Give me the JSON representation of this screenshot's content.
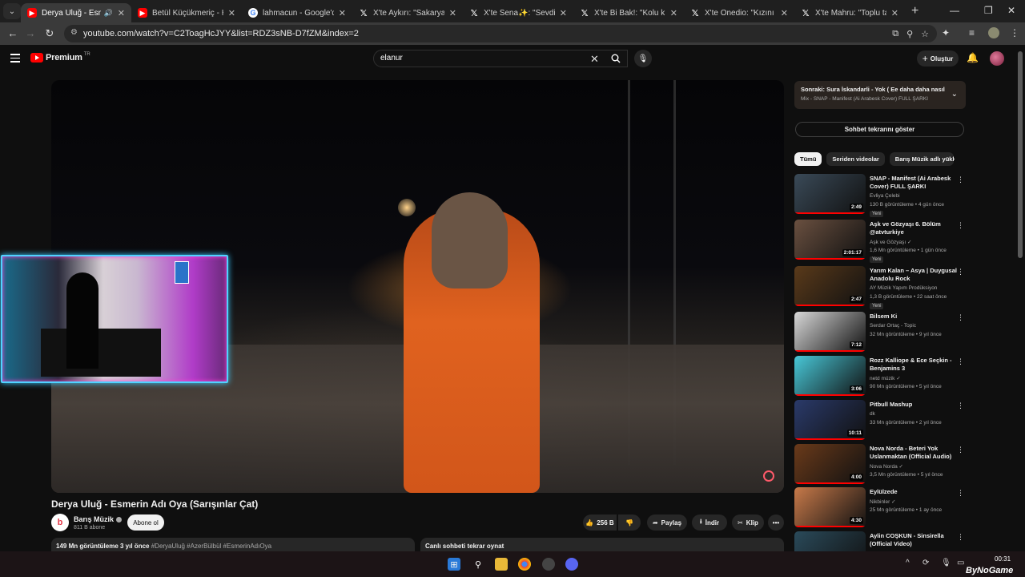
{
  "browser": {
    "tabs": [
      {
        "title": "Derya Uluğ - Esmerin",
        "fav": "yt",
        "active": true,
        "audio": true
      },
      {
        "title": "Betül Küçükmeriç - Helele",
        "fav": "yt"
      },
      {
        "title": "lahmacun - Google'da Ara",
        "fav": "g"
      },
      {
        "title": "X'te Aykırı: \"Sakarya'da bi",
        "fav": "x"
      },
      {
        "title": "X'te Sena✨: \"Sevdiğin a",
        "fav": "x"
      },
      {
        "title": "X'te Bi Bak!: \"Kolu kırılan",
        "fav": "x"
      },
      {
        "title": "X'te Onedio: \"Kızını sürekl",
        "fav": "x"
      },
      {
        "title": "X'te Mahru: \"Toplu taşıma",
        "fav": "x"
      }
    ],
    "new_tab": "+",
    "url": "youtube.com/watch?v=C2ToagHcJYY&list=RDZ3sNB-D7fZM&index=2"
  },
  "youtube": {
    "brand": "Premium",
    "brand_sup": "TR",
    "search_value": "elanur",
    "create_label": "Oluştur",
    "video": {
      "title": "Derya Uluğ - Esmerin Adı Oya (Sarışınlar Çat)",
      "channel": "Barış Müzik",
      "subscribers": "811 B abone",
      "subscribe_label": "Abone ol",
      "likes": "256 B",
      "share_label": "Paylaş",
      "download_label": "İndir",
      "clip_label": "Klip",
      "more_label": "•••",
      "views_date": "149 Mn görüntüleme  3 yıl önce",
      "tags": "#DeryaUluğ #AzerBülbül #EsmerinAdıOya",
      "chat_replay": "Canlı sohbeti tekrar oynat"
    },
    "next_up": {
      "title": "Sonraki: Sura İskandarli - Yok ( Ee daha daha nasılsın",
      "subtitle": "Mix - SNAP - Manifest (Ai Arabesk Cover) FULL ŞARKI"
    },
    "show_chat": "Sohbet tekrarını göster",
    "chips": [
      "Tümü",
      "Seriden videolar",
      "Barış Müzik adlı yükle"
    ],
    "recommendations": [
      {
        "title": "SNAP - Manifest (Ai Arabesk Cover) FULL ŞARKI",
        "channel": "Evliya Çelebi",
        "meta": "130 B görüntüleme • 4 gün önce",
        "badge": "Yeni",
        "duration": "2:49",
        "thumb": "#3a4a58"
      },
      {
        "title": "Aşk ve Gözyaşı 6. Bölüm @atvturkiye",
        "channel": "Aşk ve Gözyaşı ✓",
        "meta": "1,6 Mn görüntüleme • 1 gün önce",
        "badge": "Yeni",
        "duration": "2:01:17",
        "thumb": "#6a5040"
      },
      {
        "title": "Yarım Kalan – Asya | Duygusal Anadolu Rock",
        "channel": "AY Müzik Yapım Prodüksiyon",
        "meta": "1,3 B görüntüleme • 22 saat önce",
        "badge": "Yeni",
        "duration": "2:47",
        "thumb": "#5a3a1a"
      },
      {
        "title": "Bilsem Ki",
        "channel": "Serdar Ortaç - Topic",
        "meta": "32 Mn görüntüleme • 9 yıl önce",
        "badge": "",
        "duration": "7:12",
        "thumb": "#d8d8d8"
      },
      {
        "title": "Rozz Kalliope & Ece Seçkin - Benjamins 3",
        "channel": "netd müzik ✓",
        "meta": "90 Mn görüntüleme • 5 yıl önce",
        "badge": "",
        "duration": "3:06",
        "thumb": "#48c8d8"
      },
      {
        "title": "Pitbull Mashup",
        "channel": "dk",
        "meta": "33 Mn görüntüleme • 2 yıl önce",
        "badge": "",
        "duration": "10:11",
        "thumb": "#2a3a6a"
      },
      {
        "title": "Nova Norda - Beteri Yok Uslanmaktan (Official Audio)",
        "channel": "Nova Norda ✓",
        "meta": "3,5 Mn görüntüleme • 5 yıl önce",
        "badge": "",
        "duration": "4:00",
        "thumb": "#6a3a1a"
      },
      {
        "title": "Eylülzede",
        "channel": "Nikbinler ✓",
        "meta": "25 Mn görüntüleme • 1 ay önce",
        "badge": "",
        "duration": "4:30",
        "thumb": "#c87a4a"
      },
      {
        "title": "Aylin COŞKUN - Sinsirella (Official Video)",
        "channel": "",
        "meta": "",
        "badge": "",
        "duration": "",
        "thumb": "#2a4a5a"
      }
    ]
  },
  "taskbar": {
    "time": "00:31",
    "watermark": "ByNoGame"
  },
  "colors": {
    "accent": "#ff0000",
    "bg": "#0f0f0f"
  }
}
